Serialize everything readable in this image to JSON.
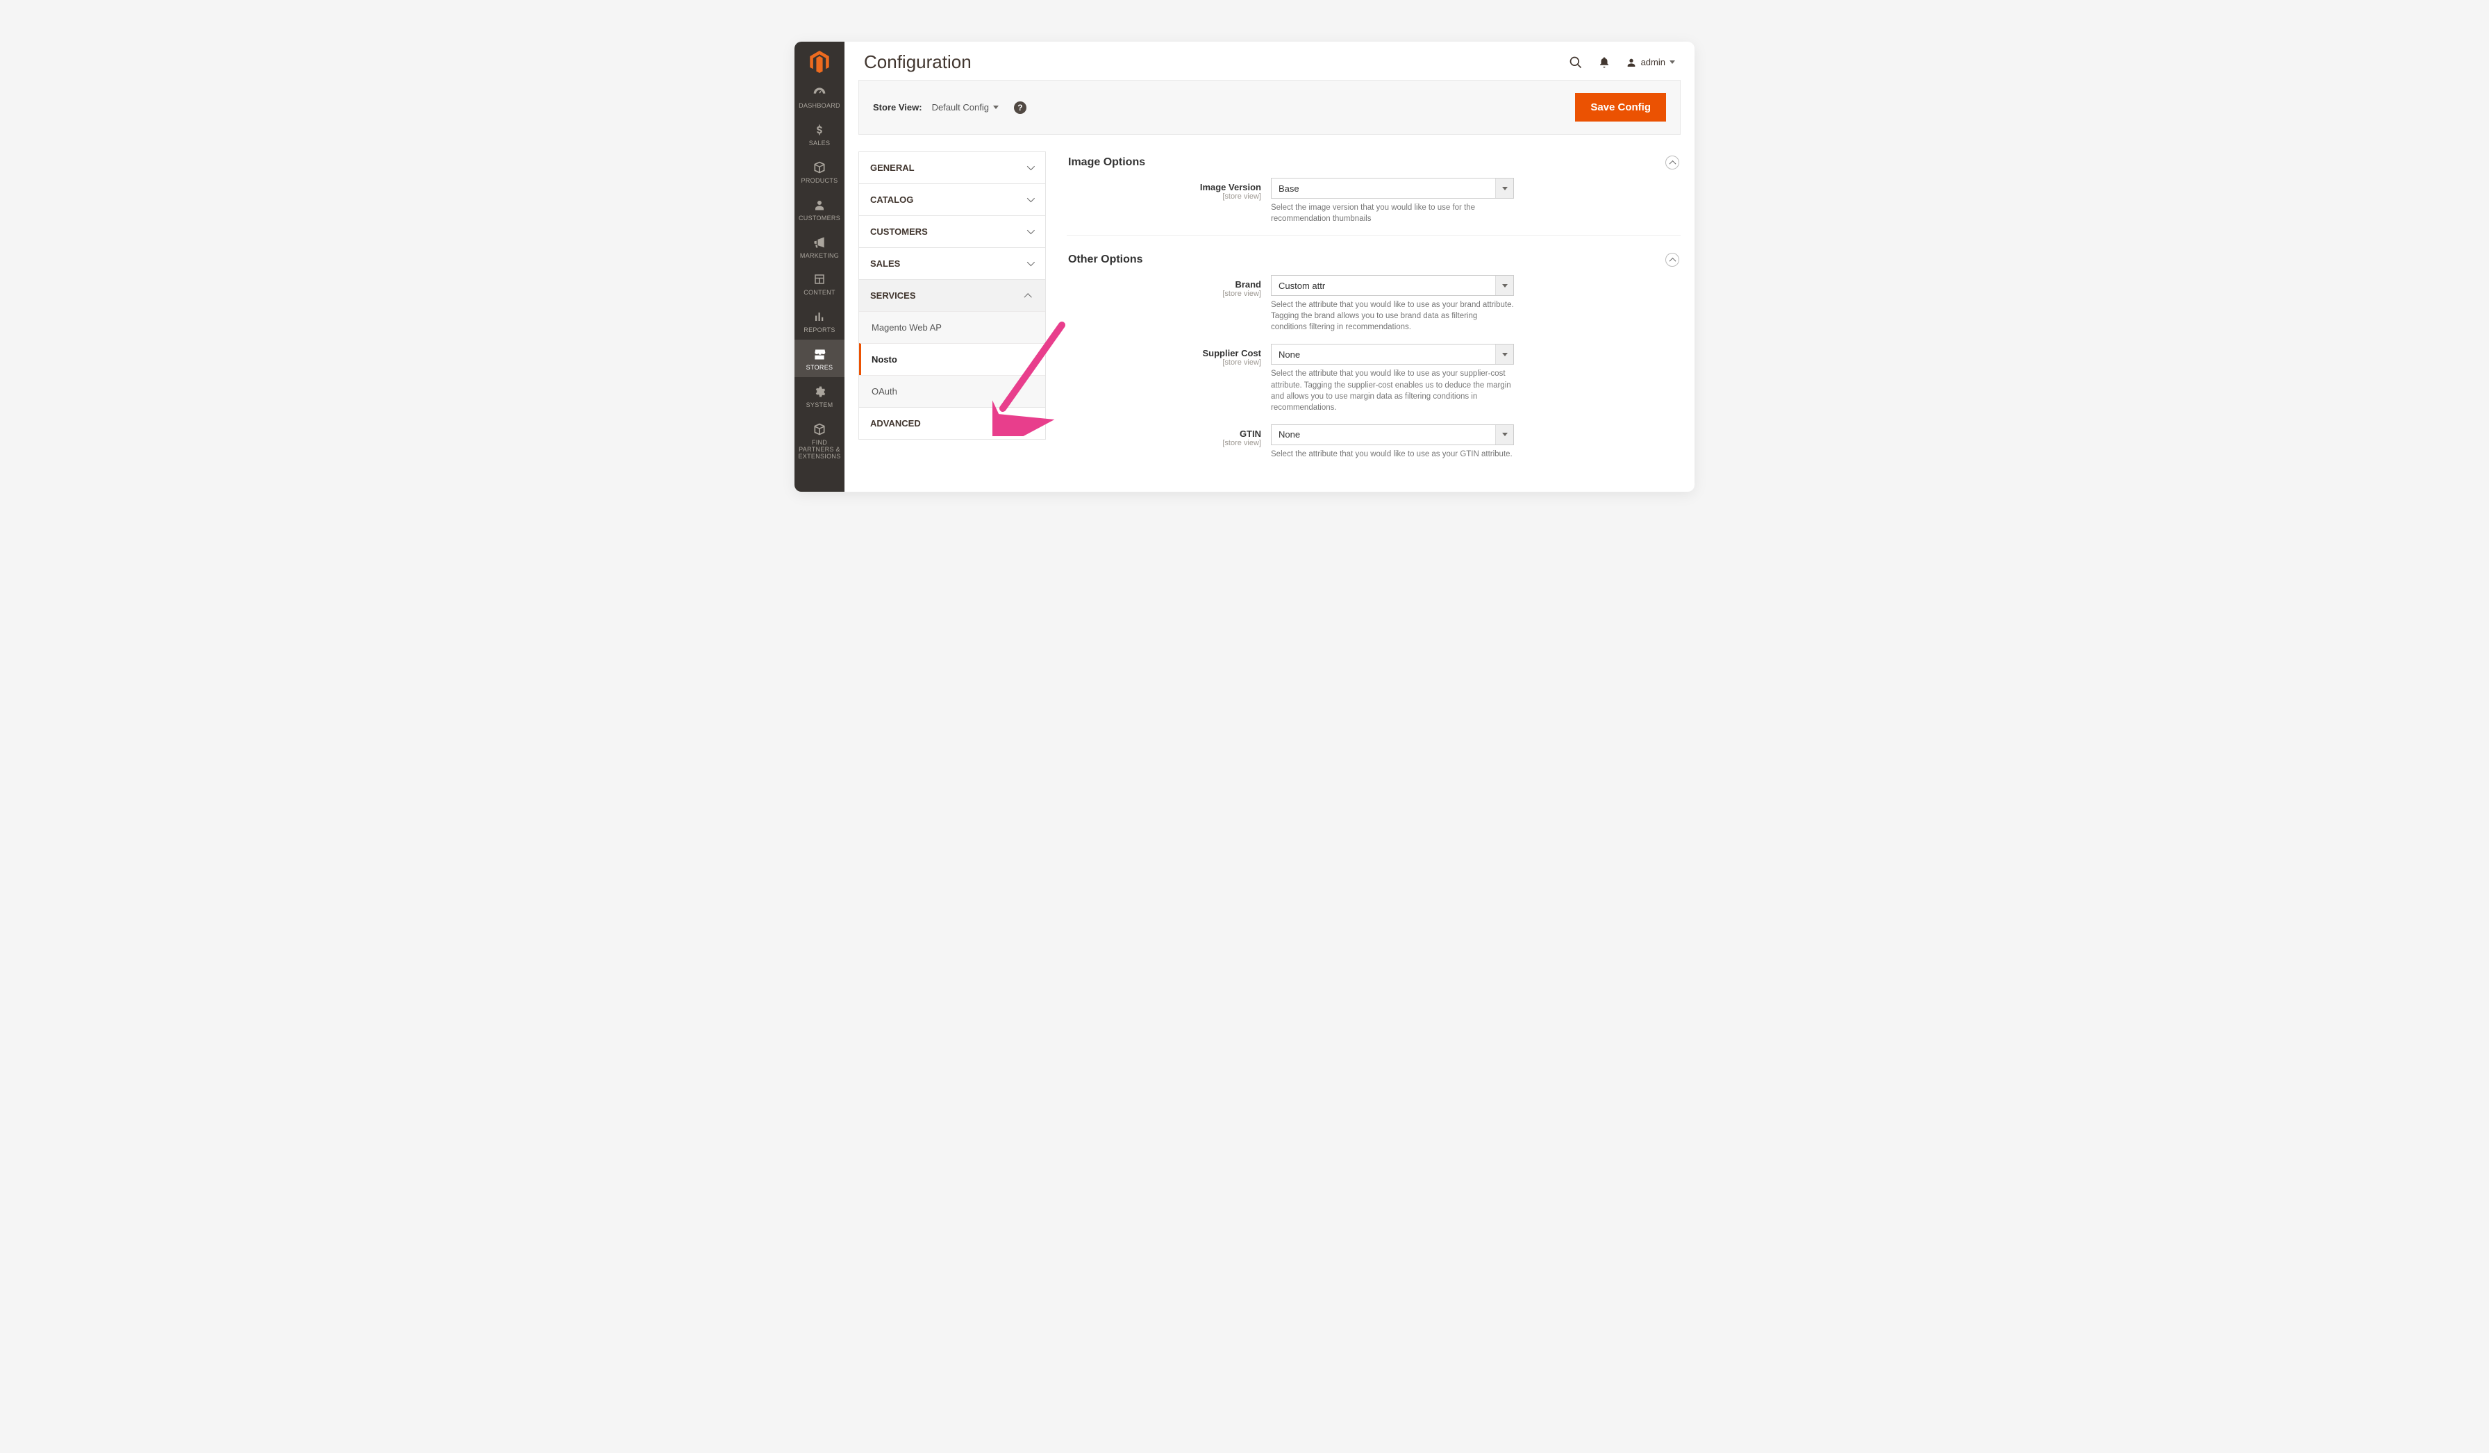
{
  "leftnav": {
    "items": [
      {
        "key": "dashboard",
        "label": "DASHBOARD"
      },
      {
        "key": "sales",
        "label": "SALES"
      },
      {
        "key": "products",
        "label": "PRODUCTS"
      },
      {
        "key": "customers",
        "label": "CUSTOMERS"
      },
      {
        "key": "marketing",
        "label": "MARKETING"
      },
      {
        "key": "content",
        "label": "CONTENT"
      },
      {
        "key": "reports",
        "label": "REPORTS"
      },
      {
        "key": "stores",
        "label": "STORES"
      },
      {
        "key": "system",
        "label": "SYSTEM"
      },
      {
        "key": "findpartners",
        "label": "FIND PARTNERS & EXTENSIONS"
      }
    ],
    "active": "stores"
  },
  "page": {
    "title": "Configuration"
  },
  "user": {
    "name": "admin"
  },
  "scopebar": {
    "label": "Store View:",
    "value": "Default Config",
    "save": "Save Config"
  },
  "cfg_sidebar": {
    "groups": [
      {
        "label": "GENERAL",
        "open": false
      },
      {
        "label": "CATALOG",
        "open": false
      },
      {
        "label": "CUSTOMERS",
        "open": false
      },
      {
        "label": "SALES",
        "open": false
      },
      {
        "label": "SERVICES",
        "open": true,
        "items": [
          {
            "label": "Magento Web AP",
            "active": false
          },
          {
            "label": "Nosto",
            "active": true
          },
          {
            "label": "OAuth",
            "active": false
          }
        ]
      },
      {
        "label": "ADVANCED",
        "open": false
      }
    ]
  },
  "sections": {
    "image": {
      "title": "Image Options",
      "fields": {
        "image_version": {
          "label": "Image Version",
          "scope": "[store view]",
          "value": "Base",
          "desc": "Select the image version that you would like to use for the recommendation thumbnails"
        }
      }
    },
    "other": {
      "title": "Other Options",
      "fields": {
        "brand": {
          "label": "Brand",
          "scope": "[store view]",
          "value": "Custom attr",
          "desc": "Select the attribute that you would like to use as your brand attribute. Tagging the brand allows you to use brand data as filtering conditions filtering in recommendations."
        },
        "supplier_cost": {
          "label": "Supplier Cost",
          "scope": "[store view]",
          "value": "None",
          "desc": "Select the attribute that you would like to use as your supplier-cost attribute. Tagging the supplier-cost enables us to deduce the margin and allows you to use margin data as filtering conditions in recommendations."
        },
        "gtin": {
          "label": "GTIN",
          "scope": "[store view]",
          "value": "None",
          "desc": "Select the attribute that you would like to use as your GTIN attribute."
        }
      }
    }
  }
}
